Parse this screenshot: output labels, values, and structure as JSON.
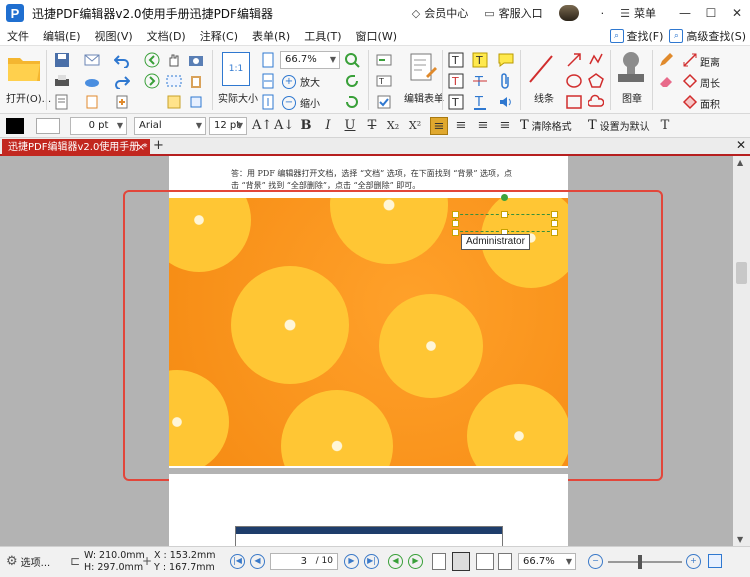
{
  "app": {
    "title": "迅捷PDF编辑器v2.0使用手册迅捷PDF编辑器",
    "logo_letter": "P"
  },
  "titlebar": {
    "vip": "会员中心",
    "service": "客服入口",
    "dots": "·",
    "menu": "菜单",
    "minimize": "—",
    "maximize": "☐",
    "close": "✕"
  },
  "menus": [
    "文件",
    "编辑(E)",
    "视图(V)",
    "文档(D)",
    "注释(C)",
    "表单(R)",
    "工具(T)",
    "窗口(W)"
  ],
  "menubar_right": {
    "find": "查找(F)",
    "advanced_find": "高级查找(S)"
  },
  "ribbon": {
    "open": "打开(O)...",
    "actual_size": "实际大小",
    "zoom_value": "66.7%",
    "zoom_in": "放大",
    "zoom_out": "缩小",
    "edit_form": "编辑表单",
    "lines": "线条",
    "stamp": "图章",
    "distance": "距离",
    "perimeter": "周长",
    "area": "面积",
    "actual_size_icon": "1:1"
  },
  "format_bar": {
    "line_width": "0 pt",
    "font": "Arial",
    "font_size": "12 pt",
    "bold": "B",
    "italic": "I",
    "underline": "U",
    "strike": "T",
    "subscript": "X₂",
    "superscript": "X²",
    "clear_format": "清除格式",
    "set_default": "设置为默认"
  },
  "tab": {
    "label": "迅捷PDF编辑器v2.0使用手册 *",
    "close": "×",
    "add": "+",
    "close_all": "✕"
  },
  "page": {
    "text_line1": "答：用 PDF 编辑器打开文档，选择 “文档” 选项，在下面找到 “背景” 选项，点",
    "text_line2": "击 “背景” 找到 “全部删除”，点击 “全部删除” 即可。",
    "tooltip": "Administrator"
  },
  "statusbar": {
    "options": "选项...",
    "width": "W: 210.0mm",
    "height": "H: 297.0mm",
    "x": "X : 153.2mm",
    "y": "Y : 167.7mm",
    "page_current": "3",
    "page_total": "/ 10",
    "zoom": "66.7%"
  },
  "colors": {
    "accent": "#c2271f",
    "brand": "#1f6fd0",
    "highlight": "#e2463a",
    "orange": "#f58a12"
  }
}
